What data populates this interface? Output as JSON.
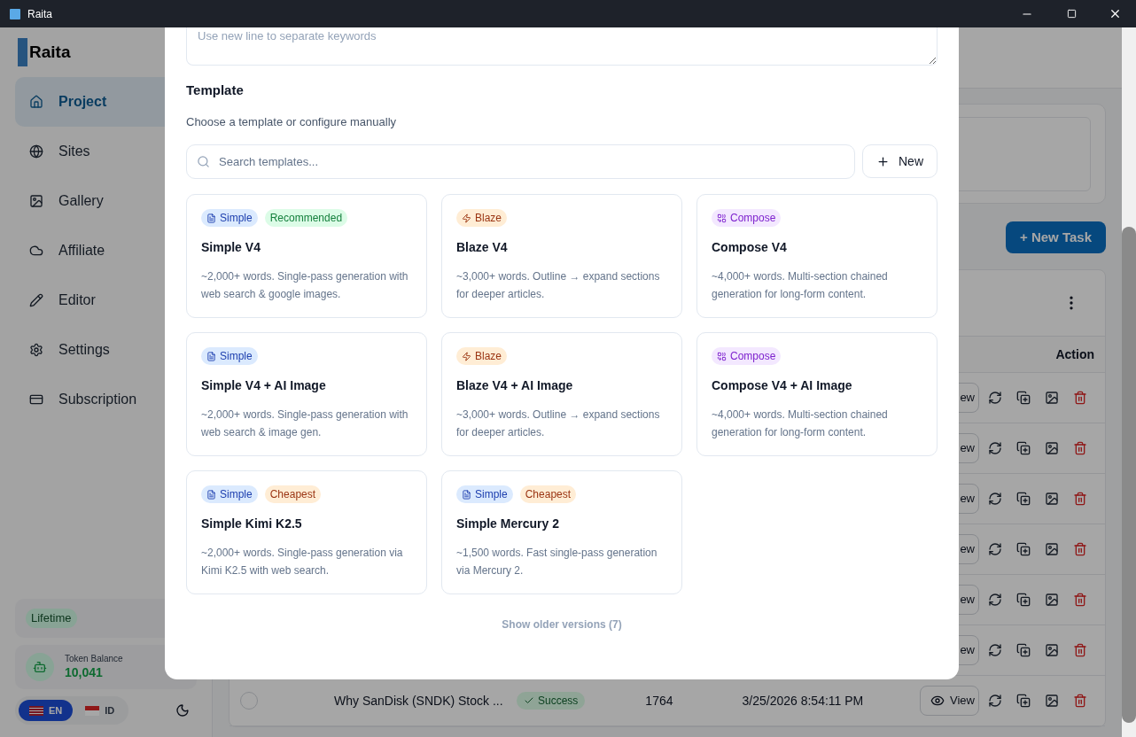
{
  "window": {
    "title": "Raita"
  },
  "sidebar": {
    "logo": "Raita",
    "items": [
      {
        "label": "Project",
        "selected": true
      },
      {
        "label": "Sites",
        "selected": false
      },
      {
        "label": "Gallery",
        "selected": false
      },
      {
        "label": "Affiliate",
        "selected": false
      },
      {
        "label": "Editor",
        "selected": false
      },
      {
        "label": "Settings",
        "selected": false
      },
      {
        "label": "Subscription",
        "selected": false
      }
    ],
    "plan": "Lifetime",
    "token_label": "Token Balance",
    "token_value": "10,041",
    "languages": [
      {
        "label": "EN",
        "selected": true
      },
      {
        "label": "ID",
        "selected": false
      }
    ]
  },
  "main": {
    "new_task": "+ New Task",
    "table": {
      "action_header": "Action",
      "rows": [
        {
          "view": "ew"
        },
        {
          "view": "ew"
        },
        {
          "view": "ew"
        },
        {
          "view": "ew"
        },
        {
          "view": "ew"
        },
        {
          "view": "ew"
        },
        {
          "checked": false,
          "title": "Why SanDisk (SNDK) Stock ...",
          "status": "Success",
          "count": "1764",
          "date": "3/25/2026 8:54:11 PM",
          "view": "View"
        }
      ]
    }
  },
  "modal": {
    "keywords_placeholder": "Use new line to separate keywords",
    "template_heading": "Template",
    "template_hint": "Choose a template or configure manually",
    "search_placeholder": "Search templates...",
    "new_button": "New",
    "templates": [
      {
        "badges": [
          {
            "kind": "simple",
            "label": "Simple"
          },
          {
            "kind": "recommended",
            "label": "Recommended"
          }
        ],
        "title": "Simple V4",
        "description": "~2,000+ words. Single-pass generation with web search & google images."
      },
      {
        "badges": [
          {
            "kind": "blaze",
            "label": "Blaze"
          }
        ],
        "title": "Blaze V4",
        "description": "~3,000+ words. Outline → expand sections for deeper articles."
      },
      {
        "badges": [
          {
            "kind": "compose",
            "label": "Compose"
          }
        ],
        "title": "Compose V4",
        "description": "~4,000+ words. Multi-section chained generation for long-form content."
      },
      {
        "badges": [
          {
            "kind": "simple",
            "label": "Simple"
          }
        ],
        "title": "Simple V4 + AI Image",
        "description": "~2,000+ words. Single-pass generation with web search & image gen."
      },
      {
        "badges": [
          {
            "kind": "blaze",
            "label": "Blaze"
          }
        ],
        "title": "Blaze V4 + AI Image",
        "description": "~3,000+ words. Outline → expand sections for deeper articles."
      },
      {
        "badges": [
          {
            "kind": "compose",
            "label": "Compose"
          }
        ],
        "title": "Compose V4 + AI Image",
        "description": "~4,000+ words. Multi-section chained generation for long-form content."
      },
      {
        "badges": [
          {
            "kind": "simple",
            "label": "Simple"
          },
          {
            "kind": "cheapest",
            "label": "Cheapest"
          }
        ],
        "title": "Simple Kimi K2.5",
        "description": "~2,000+ words. Single-pass generation via Kimi K2.5 with web search."
      },
      {
        "badges": [
          {
            "kind": "simple",
            "label": "Simple"
          },
          {
            "kind": "cheapest",
            "label": "Cheapest"
          }
        ],
        "title": "Simple Mercury 2",
        "description": "~1,500 words. Fast single-pass generation via Mercury 2."
      }
    ],
    "show_older": "Show older versions (7)"
  }
}
